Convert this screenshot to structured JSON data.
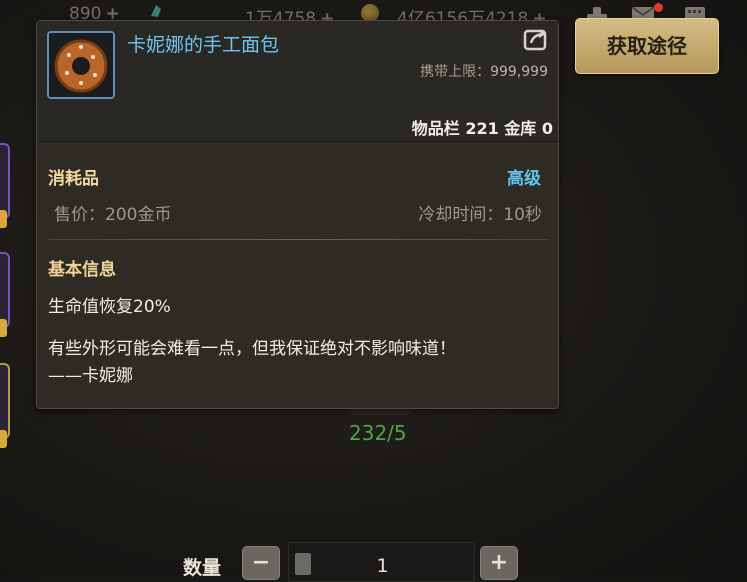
{
  "topbar": {
    "currency1": "890",
    "currency2": "1万4758",
    "currency3": "4亿6156万4218",
    "plus": "+"
  },
  "tooltip": {
    "item_name": "卡妮娜的手工面包",
    "carry_label": "携带上限：",
    "carry_value": "999,999",
    "inventory": "物品栏 221 金库 0",
    "type": "消耗品",
    "grade": "高级",
    "price": "售价：200金币",
    "cooldown": "冷却时间：10秒",
    "section_title": "基本信息",
    "effect": "生命值恢复20%",
    "desc_line1": "有些外形可能会难看一点，但我保证绝对不影响味道！",
    "desc_line2": "——卡妮娜",
    "name_color": "#6fc4ee",
    "grade_color": "#5fc5e9"
  },
  "get_path_button": "获取途径",
  "count_text": "232/5",
  "quantity": {
    "label": "数量",
    "minus": "−",
    "plus": "+",
    "value": "1"
  },
  "icons": {
    "item": "bread-ring-icon",
    "share": "share-icon",
    "gem": "gem-icon",
    "coin": "gold-coin-icon",
    "mail": "mail-icon",
    "calculator": "calculator-icon"
  }
}
